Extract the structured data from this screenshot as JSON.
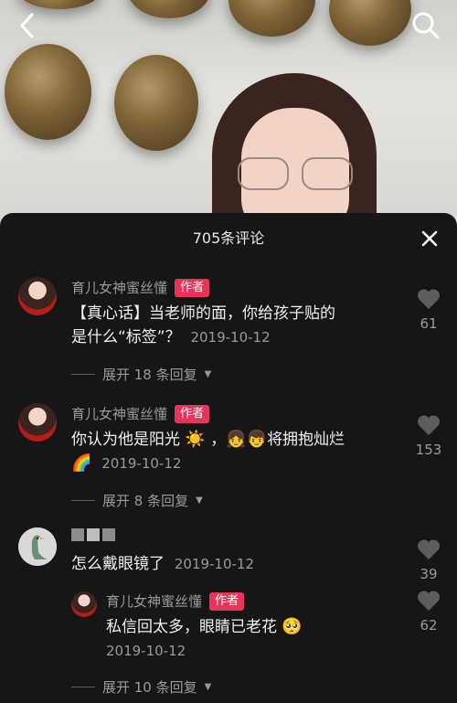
{
  "nav": {
    "back_icon": "chevron-left-icon",
    "search_icon": "search-icon"
  },
  "sheet": {
    "title": "705条评论",
    "close_icon": "close-icon"
  },
  "comments": [
    {
      "author": "育儿女神蜜丝懂",
      "badge": "作者",
      "text": "【真心话】当老师的面，你给孩子贴的是什么“标签”？",
      "line1": "【真心话】当老师的面，你给孩子贴的",
      "line2": "是什么“标签”？",
      "date": "2019-10-12",
      "likes": "61",
      "expand": "展开 18 条回复"
    },
    {
      "author": "育儿女神蜜丝懂",
      "badge": "作者",
      "line1": "你认为他是阳光",
      "emoji_sun": "☀️",
      "emoji_kids": "👧👦",
      "line1_end": "将拥抱灿烂",
      "emoji_rainbow": "🌈",
      "date": "2019-10-12",
      "likes": "153",
      "expand": "展开 8 条回复"
    },
    {
      "text": "怎么戴眼镜了",
      "date": "2019-10-12",
      "likes": "39",
      "reply": {
        "author": "育儿女神蜜丝懂",
        "badge": "作者",
        "text": "私信回太多，眼睛已老花",
        "emoji": "🥺",
        "date": "2019-10-12",
        "likes": "62"
      },
      "expand": "展开 10 条回复"
    }
  ]
}
